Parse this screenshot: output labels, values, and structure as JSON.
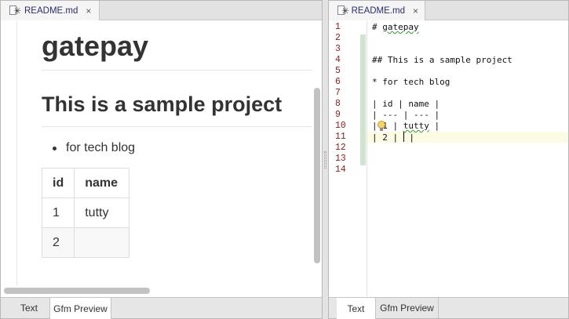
{
  "left_pane": {
    "tab": {
      "label": "README.md",
      "close_glyph": "×"
    },
    "preview": {
      "h1": "gatepay",
      "h2": "This is a sample project",
      "list_item": "for tech blog",
      "table": {
        "headers": [
          "id",
          "name"
        ],
        "rows": [
          [
            "1",
            "tutty"
          ],
          [
            "2",
            ""
          ]
        ]
      }
    },
    "bottom_tabs": [
      {
        "label": "Text",
        "active": false
      },
      {
        "label": "Gfm Preview",
        "active": true
      }
    ]
  },
  "right_pane": {
    "tab": {
      "label": "README.md",
      "close_glyph": "×"
    },
    "line_numbers": [
      "1",
      "2",
      "3",
      "4",
      "5",
      "6",
      "7",
      "8",
      "9",
      "10",
      "11",
      "12",
      "13",
      "14"
    ],
    "lines": {
      "l1_prefix": "# ",
      "l1_word": "gatepay",
      "l4": "## This is a sample project",
      "l6": "* for tech blog",
      "l8": "| id | name |",
      "l9": "| --- | --- |",
      "l10_prefix": "| 1 | ",
      "l10_word": "tutty",
      "l10_suffix": " |",
      "l11_prefix": "| 2 | ",
      "l11_suffix": " |"
    },
    "bottom_tabs": [
      {
        "label": "Text",
        "active": true
      },
      {
        "label": "Gfm Preview",
        "active": false
      }
    ]
  },
  "colors": {
    "tab_text": "#2b2b6b",
    "line_number": "#8a1c1c",
    "change_bar": "#cfe5cf",
    "current_line": "#fdfbe4"
  }
}
